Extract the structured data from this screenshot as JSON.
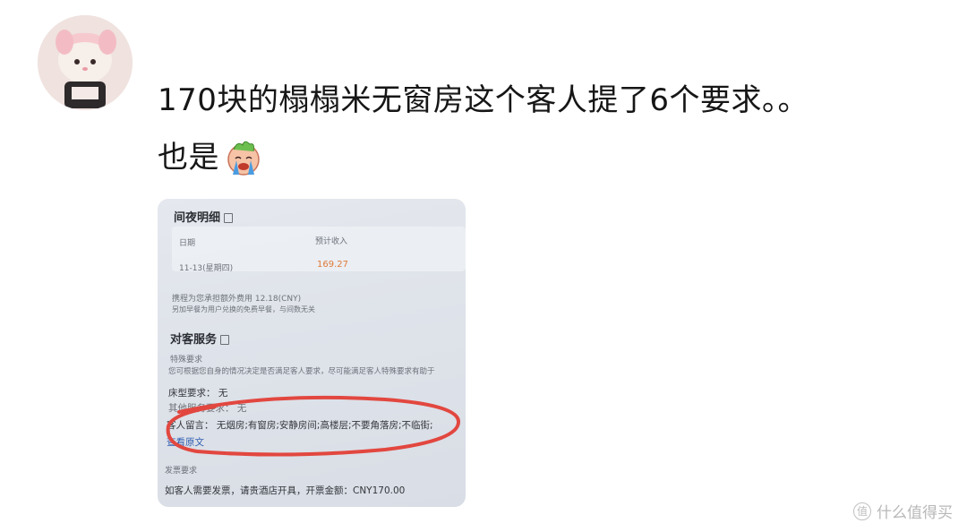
{
  "post": {
    "line1": "170块的榻榻米无窗房这个客人提了6个要求。。",
    "line2": "也是"
  },
  "emoji": {
    "icon": "crying-face-emoji"
  },
  "photo": {
    "section_title_1": "间夜明细",
    "col_date": "日期",
    "col_income": "预计收入",
    "row_date": "11-13(星期四)",
    "row_income": "169.27",
    "fee_note": "携程为您承担额外费用 12.18(CNY)",
    "breakfast_note": "另加早餐为用户兑换的免费早餐，与间数无关",
    "section_title_2": "对客服务",
    "special_req": "特殊要求",
    "special_desc": "您可根据您自身的情况决定是否满足客人要求，尽可能满足客人特殊要求有助于",
    "bed_req": "床型要求：  无",
    "other_req": "其他服务要求：  无",
    "guest_msg_label": "客人留言：",
    "guest_msg": "无烟房;有窗房;安静房间;高楼层;不要角落房;不临街;",
    "view_original": "查看原文",
    "invoice_title": "发票要求",
    "invoice_text": "如客人需要发票，请贵酒店开具，开票金额：CNY170.00"
  },
  "watermark": {
    "text": "什么值得买",
    "logo_char": "值"
  }
}
